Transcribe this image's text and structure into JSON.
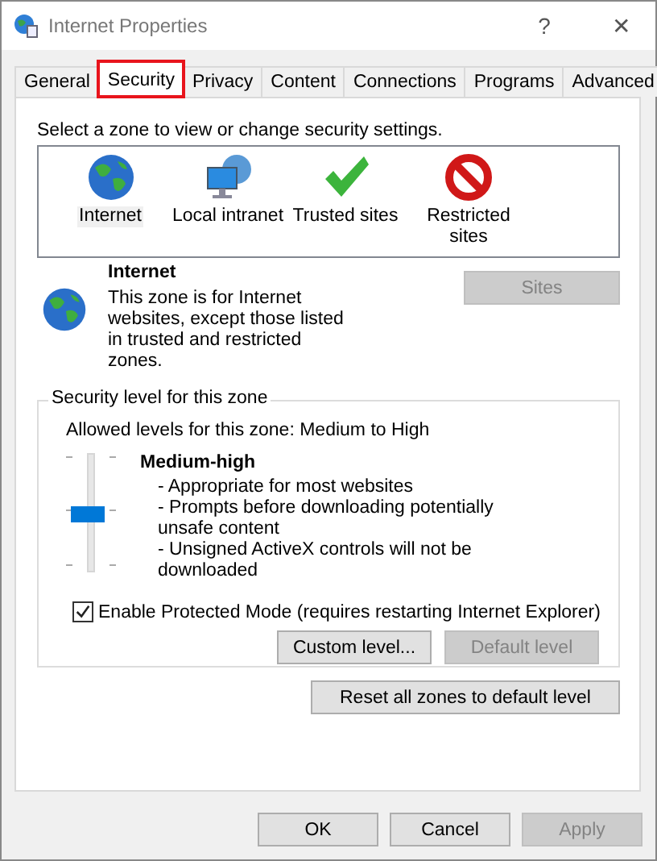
{
  "window": {
    "title": "Internet Properties",
    "help": "?",
    "close": "✕"
  },
  "tabs": [
    {
      "label": "General",
      "selected": false,
      "outlined": false
    },
    {
      "label": "Security",
      "selected": true,
      "outlined": true
    },
    {
      "label": "Privacy",
      "selected": false,
      "outlined": false
    },
    {
      "label": "Content",
      "selected": false,
      "outlined": false
    },
    {
      "label": "Connections",
      "selected": false,
      "outlined": false
    },
    {
      "label": "Programs",
      "selected": false,
      "outlined": false
    },
    {
      "label": "Advanced",
      "selected": false,
      "outlined": false
    }
  ],
  "zone_prompt": "Select a zone to view or change security settings.",
  "zones": [
    {
      "label": "Internet",
      "kind": "globe",
      "selected": true
    },
    {
      "label": "Local intranet",
      "kind": "intranet",
      "selected": false
    },
    {
      "label": "Trusted sites",
      "kind": "check",
      "selected": false
    },
    {
      "label": "Restricted sites",
      "kind": "blocked",
      "selected": false
    }
  ],
  "zone_detail": {
    "title": "Internet",
    "description": "This zone is for Internet websites, except those listed in trusted and restricted zones.",
    "sites_button": {
      "label": "Sites",
      "disabled": true
    }
  },
  "security_level": {
    "legend": "Security level for this zone",
    "allowed": "Allowed levels for this zone: Medium to High",
    "level": 0.5,
    "level_name": "Medium-high",
    "points": [
      "- Appropriate for most websites",
      "- Prompts before downloading potentially unsafe content",
      "- Unsigned ActiveX controls will not be downloaded"
    ],
    "protected_mode": {
      "label": "Enable Protected Mode (requires restarting Internet Explorer)",
      "checked": true
    },
    "buttons": [
      {
        "label": "Custom level...",
        "disabled": false
      },
      {
        "label": "Default level",
        "disabled": true
      }
    ]
  },
  "reset_button": {
    "label": "Reset all zones to default level",
    "disabled": false
  },
  "dialog_buttons": [
    {
      "label": "OK",
      "disabled": false
    },
    {
      "label": "Cancel",
      "disabled": false
    },
    {
      "label": "Apply",
      "disabled": true
    }
  ]
}
